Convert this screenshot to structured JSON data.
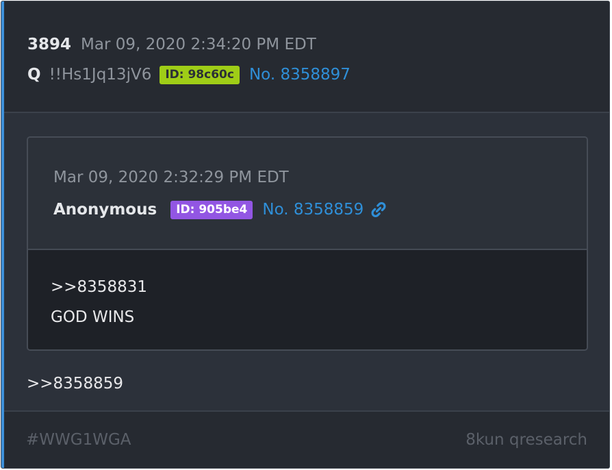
{
  "post": {
    "number": "3894",
    "timestamp": "Mar 09, 2020 2:34:20 PM EDT",
    "author": "Q",
    "tripcode": "!!Hs1Jq13jV6",
    "id_label": "ID: 98c60c",
    "post_link": "No. 8358897",
    "id_color": "#9fcd17",
    "link_color": "#2f8fd8"
  },
  "quoted_post": {
    "timestamp": "Mar 09, 2020 2:32:29 PM EDT",
    "author": "Anonymous",
    "id_label": "ID: 905be4",
    "post_link": "No. 8358859",
    "link_icon": "link-icon",
    "id_color": "#9256e3",
    "body": [
      ">>8358831",
      "GOD WINS"
    ]
  },
  "body": [
    ">>8358859"
  ],
  "footer": {
    "hashtag": "#WWG1WGA",
    "source": "8kun qresearch"
  }
}
